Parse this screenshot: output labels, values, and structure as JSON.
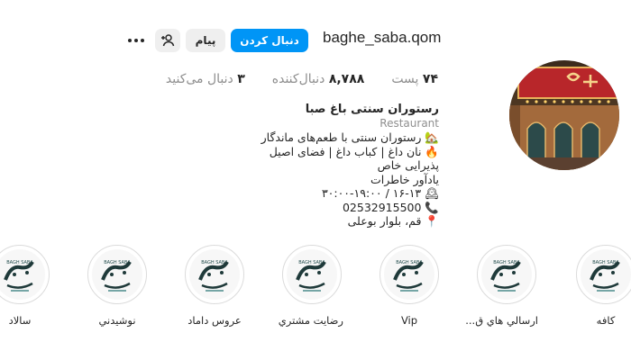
{
  "header": {
    "username": "baghe_saba.qom",
    "follow_label": "دنبال کردن",
    "message_label": "پیام",
    "suggest_icon": "add-user-icon",
    "more_icon": "more-horizontal-icon"
  },
  "stats": {
    "posts_value": "۷۴",
    "posts_label": "پست",
    "followers_value": "۸,۷۸۸",
    "followers_label": "دنبال‌کننده",
    "following_value": "۳",
    "following_label": "دنبال می‌کنید"
  },
  "bio": {
    "name": "رستوران سنتی باغ صبا",
    "category": "Restaurant",
    "line1": "🏡 رستوران سنتی با طعم‌های ماندگار",
    "line2": "🔥 نان داغ | کباب داغ | فضای اصیل",
    "line3": "پذیرایی خاص",
    "line4": "یادآور خاطرات",
    "line5": "🕰 ۱۶-۱۳ / ۳۰:۰۰-۱۹:۰۰",
    "line6": "📞 02532915500",
    "line7": "📍 قم، بلوار بوعلی"
  },
  "highlights": [
    {
      "label": "کافه"
    },
    {
      "label": "ارسالي هاي ق..."
    },
    {
      "label": "Vip"
    },
    {
      "label": "رضایت مشتري"
    },
    {
      "label": "عروس داماد"
    },
    {
      "label": "نوشیدني"
    },
    {
      "label": "سالاد"
    }
  ],
  "highlight_logo_text": "باغ صبا",
  "highlight_logo_sub": "BAGH SABA",
  "colors": {
    "accent": "#0095f6",
    "muted": "#8e8e8e",
    "button_bg": "#efefef"
  }
}
